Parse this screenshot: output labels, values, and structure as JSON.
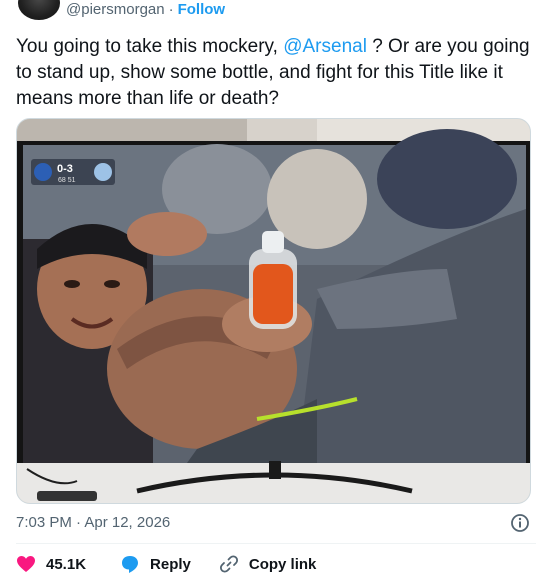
{
  "header": {
    "handle": "@piersmorgan",
    "separator": "·",
    "follow_label": "Follow"
  },
  "tweet": {
    "text_before": "You going to take this mockery, ",
    "mention": "@Arsenal",
    "text_after": " ? Or are you going to stand up, show some bottle, and fight for this Title like it means more than life or death?"
  },
  "media": {
    "scorebug": {
      "score": "0-3",
      "clock": "68 51"
    }
  },
  "footer": {
    "timestamp": "7:03 PM · Apr 12, 2026"
  },
  "actions": {
    "likes": "45.1K",
    "reply_label": "Reply",
    "copy_label": "Copy link"
  },
  "colors": {
    "accent": "#1d9bf0",
    "like": "#f91880",
    "reply_icon": "#1d9bf0",
    "muted": "#536471"
  }
}
